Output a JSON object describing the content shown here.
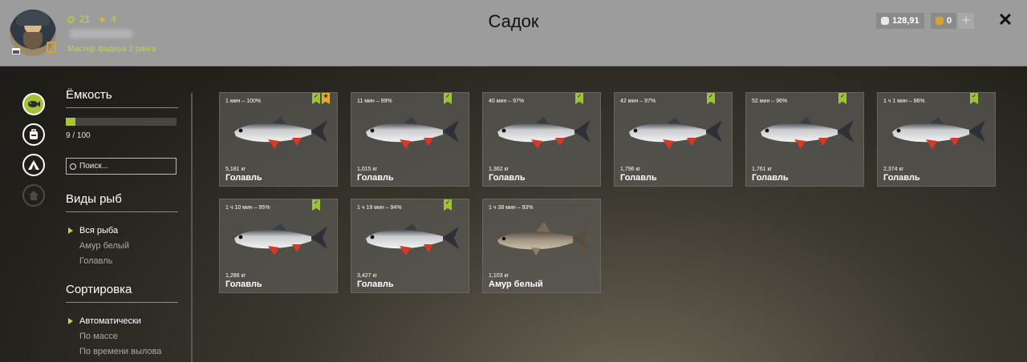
{
  "header": {
    "title": "Садок",
    "player": {
      "level": "21",
      "stars": "4",
      "rank_title": "Мастер фидера 2 ранга"
    },
    "currency": {
      "silver": "128,91",
      "gold": "0"
    }
  },
  "rail": [
    {
      "name": "fish-keepnet-icon",
      "active": true
    },
    {
      "name": "backpack-icon",
      "active": false
    },
    {
      "name": "camp-icon",
      "active": false
    },
    {
      "name": "home-icon",
      "active": false,
      "disabled": true
    }
  ],
  "capacity": {
    "title": "Ёмкость",
    "text": "9 / 100",
    "fraction": 0.09
  },
  "search": {
    "placeholder": "Поиск..."
  },
  "species": {
    "title": "Виды рыб",
    "items": [
      "Вся рыба",
      "Амур белый",
      "Голавль"
    ],
    "selected": 0
  },
  "sorting": {
    "title": "Сортировка",
    "items": [
      "Автоматически",
      "По массе",
      "По времени вылова"
    ],
    "selected": 0
  },
  "fish_cards": [
    {
      "time": "1 мин – 100%",
      "weight": "5,181 кг",
      "name": "Голавль",
      "kind": "chub",
      "badges": [
        "green",
        "gold"
      ]
    },
    {
      "time": "11 мин – 99%",
      "weight": "1,015 кг",
      "name": "Голавль",
      "kind": "chub",
      "badges": [
        "green"
      ]
    },
    {
      "time": "40 мин – 97%",
      "weight": "1,362 кг",
      "name": "Голавль",
      "kind": "chub",
      "badges": [
        "green"
      ]
    },
    {
      "time": "42 мин – 97%",
      "weight": "1,796 кг",
      "name": "Голавль",
      "kind": "chub",
      "badges": [
        "green"
      ]
    },
    {
      "time": "52 мин – 96%",
      "weight": "1,761 кг",
      "name": "Голавль",
      "kind": "chub",
      "badges": [
        "green"
      ]
    },
    {
      "time": "1 ч 1 мин – 96%",
      "weight": "2,374 кг",
      "name": "Голавль",
      "kind": "chub",
      "badges": [
        "green"
      ]
    },
    {
      "time": "1 ч 10 мин – 95%",
      "weight": "1,286 кг",
      "name": "Голавль",
      "kind": "chub",
      "badges": [
        "green"
      ]
    },
    {
      "time": "1 ч 19 мин – 94%",
      "weight": "3,427 кг",
      "name": "Голавль",
      "kind": "chub",
      "badges": [
        "green"
      ]
    },
    {
      "time": "1 ч 38 мин – 93%",
      "weight": "1,103 кг",
      "name": "Амур белый",
      "kind": "carp",
      "badges": []
    }
  ]
}
